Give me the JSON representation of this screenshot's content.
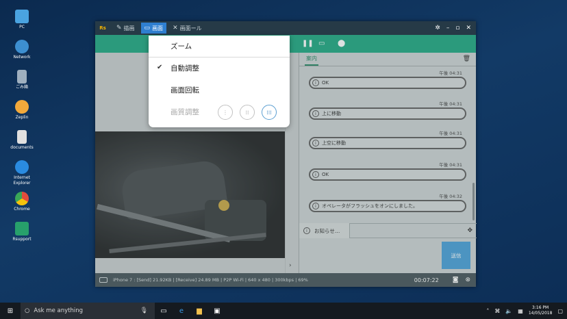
{
  "desktop": {
    "icons": [
      {
        "label": "PC",
        "color": "#4aa3e0"
      },
      {
        "label": "Network",
        "color": "#4aa3e0"
      },
      {
        "label": "ごみ箱",
        "color": "#9fb0bf"
      },
      {
        "label": "Zeplin",
        "color": "#f2a93b"
      },
      {
        "label": "documents",
        "color": "#e0e0e0"
      },
      {
        "label": "Internet Explorer",
        "color": "#2a8be0"
      },
      {
        "label": "Chrome",
        "color": "#e24c3c"
      },
      {
        "label": "Rsupport",
        "color": "#27a06b"
      }
    ]
  },
  "window": {
    "logo": "Rs",
    "tabs": [
      {
        "label": "描画",
        "icon": "pen-icon"
      },
      {
        "label": "画面",
        "icon": "monitor-icon",
        "active": true
      },
      {
        "label": "画面ール",
        "icon": "tools-icon"
      }
    ]
  },
  "menu": {
    "items": [
      {
        "label": "ズーム",
        "checked": false
      },
      {
        "label": "自動調整",
        "checked": true
      },
      {
        "label": "画面回転",
        "checked": false
      }
    ],
    "quality": {
      "label": "画質調整",
      "options": [
        "low",
        "medium",
        "high"
      ],
      "selected": "high"
    }
  },
  "chat": {
    "tab_label": "案内",
    "messages": [
      {
        "time": "午後 04:31",
        "text": "OK"
      },
      {
        "time": "午後 04:31",
        "text": "上に移動"
      },
      {
        "time": "午後 04:31",
        "text": "上空に移動"
      },
      {
        "time": "午後 04:31",
        "text": "OK"
      },
      {
        "time": "午後 04:32",
        "text": "オペレータがフラッシュをオンにしました。"
      }
    ],
    "notice_tab": "お知らせ…",
    "send_label": "送信"
  },
  "status": {
    "info": "iPhone 7 : [Send] 21.92KB  |  [Receive] 24.89 MB  |  P2P Wi-Fi  |  640 x 480  |  300kbps  |  69%",
    "timer": "00:07:22"
  },
  "taskbar": {
    "search_placeholder": "Ask me anything",
    "time": "3:16 PM",
    "date": "14/05/2018"
  }
}
